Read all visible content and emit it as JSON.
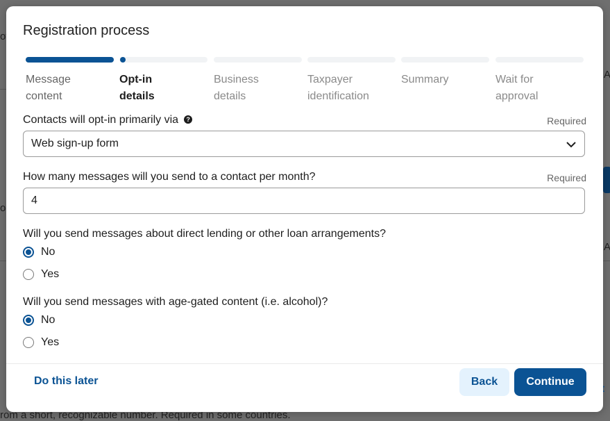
{
  "background": {
    "fragments": [
      "of",
      "A",
      "o",
      "A",
      "ur",
      "t",
      "rom a short, recognizable number. Required in some countries."
    ]
  },
  "modal": {
    "title": "Registration process",
    "steps": [
      {
        "label_line1": "Message",
        "label_line2": "content",
        "state": "done"
      },
      {
        "label_line1": "Opt-in",
        "label_line2": "details",
        "state": "active"
      },
      {
        "label_line1": "Business",
        "label_line2": "details",
        "state": "pending"
      },
      {
        "label_line1": "Taxpayer",
        "label_line2": "identification",
        "state": "pending"
      },
      {
        "label_line1": "Summary",
        "label_line2": "",
        "state": "pending"
      },
      {
        "label_line1": "Wait for",
        "label_line2": "approval",
        "state": "pending"
      }
    ],
    "optin": {
      "label": "Contacts will opt-in primarily via",
      "help_icon": "question-circle-icon",
      "required": "Required",
      "value": "Web sign-up form"
    },
    "messages_per_month": {
      "label": "How many messages will you send to a contact per month?",
      "required": "Required",
      "value": "4"
    },
    "lending": {
      "label": "Will you send messages about direct lending or other loan arrangements?",
      "options": [
        "No",
        "Yes"
      ],
      "selected": "No"
    },
    "age_gated": {
      "label": "Will you send messages with age-gated content (i.e. alcohol)?",
      "options": [
        "No",
        "Yes"
      ],
      "selected": "No"
    },
    "footer": {
      "later": "Do this later",
      "back": "Back",
      "continue": "Continue"
    },
    "colors": {
      "accent": "#0b5394",
      "back_bg": "#e4f2fd"
    }
  }
}
